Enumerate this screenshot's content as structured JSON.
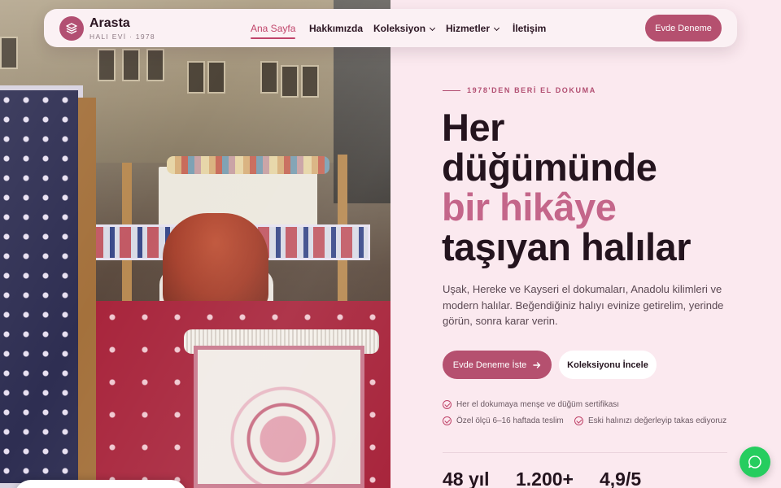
{
  "brand": {
    "name": "Arasta",
    "subtitle": "HALI EVİ · 1978"
  },
  "nav": {
    "links": [
      {
        "label": "Ana Sayfa",
        "active": true
      },
      {
        "label": "Hakkımızda",
        "active": false
      },
      {
        "label": "Koleksiyon",
        "active": false,
        "dropdown": true
      },
      {
        "label": "Hizmetler",
        "active": false,
        "dropdown": true
      },
      {
        "label": "İletişim",
        "active": false
      }
    ],
    "cta": "Evde Deneme"
  },
  "hero": {
    "eyebrow": "1978'DEN BERİ EL DOKUMA",
    "title_line1": "Her",
    "title_line2": "düğümünde",
    "title_accent": "bir hikâye",
    "title_line4": "taşıyan halılar",
    "lead": "Uşak, Hereke ve Kayseri el dokumaları, Anadolu kilimleri ve modern halılar. Beğendiğiniz halıyı evinize getirelim, yerinde görün, sonra karar verin.",
    "primary_button": "Evde Deneme İste",
    "secondary_button": "Koleksiyonu İncele",
    "features": [
      "Her el dokumaya menşe ve düğüm sertifikası",
      "Özel ölçü 6–16 haftada teslim",
      "Eski halınızı değerleyip takas ediyoruz"
    ],
    "stats": [
      "48 yıl",
      "1.200+",
      "4,9/5"
    ]
  },
  "colors": {
    "accent": "#b5506f",
    "accent_text": "#c4668a",
    "background": "#fbe9ef",
    "whatsapp": "#26cd5f"
  },
  "icons": {
    "logo": "layers-icon",
    "arrow": "arrow-right-icon",
    "chat": "whatsapp-icon",
    "check": "check-circle-icon"
  }
}
